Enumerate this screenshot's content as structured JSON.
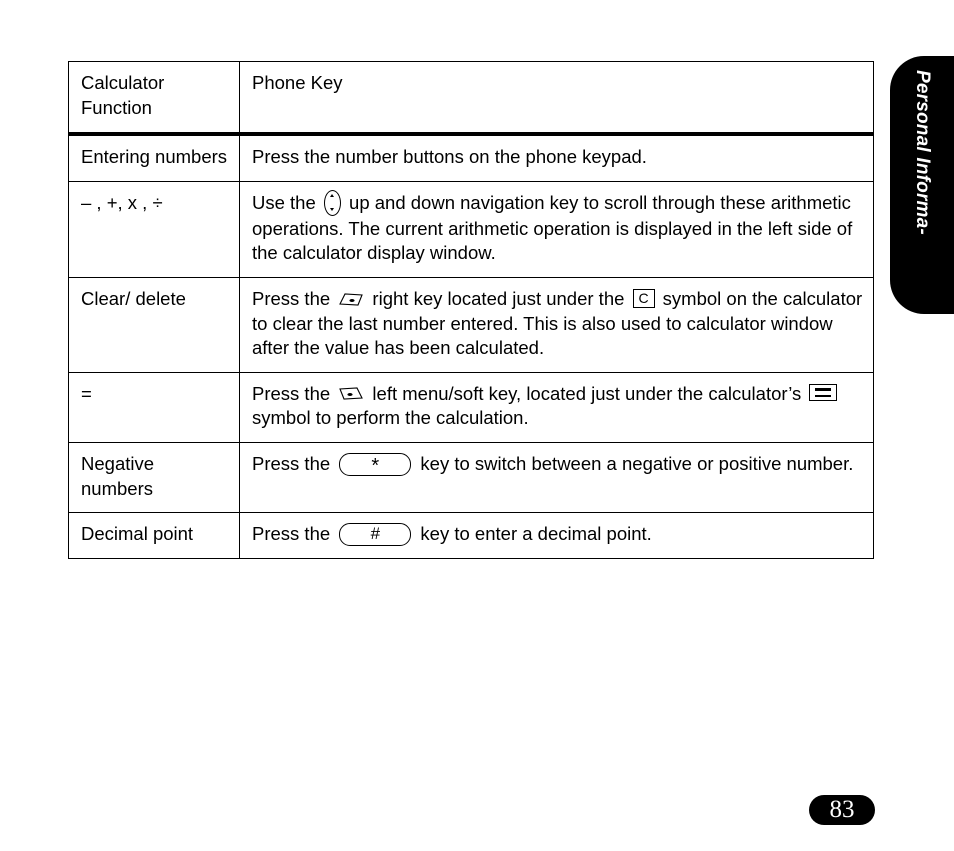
{
  "side_tab": {
    "label": "Personal Informa-"
  },
  "page_number": "83",
  "table": {
    "headers": {
      "function": "Calculator Function",
      "phone_key": "Phone Key"
    },
    "rows": [
      {
        "function": "Entering numbers",
        "parts": [
          {
            "kind": "text",
            "value": "Press the number buttons on the phone keypad."
          }
        ]
      },
      {
        "function": "– , +, x , ÷",
        "parts": [
          {
            "kind": "text",
            "value": "Use the "
          },
          {
            "kind": "icon",
            "value": "navigation-key-icon"
          },
          {
            "kind": "text",
            "value": " up and down navigation key to scroll through these arithmetic operations. The current arithmetic operation is displayed in the left side of the calculator display window."
          }
        ]
      },
      {
        "function": "Clear/ delete",
        "parts": [
          {
            "kind": "text",
            "value": "Press the "
          },
          {
            "kind": "icon",
            "value": "right-soft-key-icon"
          },
          {
            "kind": "text",
            "value": " right key located just under the "
          },
          {
            "kind": "icon",
            "value": "clear-c-symbol-icon",
            "label": "C"
          },
          {
            "kind": "text",
            "value": " symbol on the calculator to clear the last number entered. This is also used to calculator window after the value has been calculated."
          }
        ]
      },
      {
        "function": "=",
        "parts": [
          {
            "kind": "text",
            "value": " Press the "
          },
          {
            "kind": "icon",
            "value": "left-soft-key-icon"
          },
          {
            "kind": "text",
            "value": " left menu/soft key, located just under the calculator’s "
          },
          {
            "kind": "icon",
            "value": "equals-menu-symbol-icon"
          },
          {
            "kind": "text",
            "value": " symbol to perform the calculation."
          }
        ]
      },
      {
        "function": "Negative numbers",
        "parts": [
          {
            "kind": "text",
            "value": "Press the "
          },
          {
            "kind": "icon",
            "value": "star-key-icon",
            "label": "*"
          },
          {
            "kind": "text",
            "value": " key to switch between a negative or positive number."
          }
        ]
      },
      {
        "function": "Decimal point",
        "parts": [
          {
            "kind": "text",
            "value": "Press the "
          },
          {
            "kind": "icon",
            "value": "pound-key-icon",
            "label": "#"
          },
          {
            "kind": "text",
            "value": " key to enter a decimal point."
          }
        ]
      }
    ]
  },
  "colors": {
    "ink": "#000000",
    "page": "#ffffff"
  }
}
